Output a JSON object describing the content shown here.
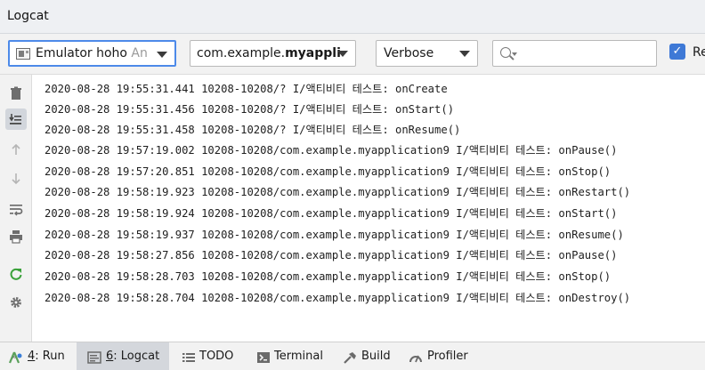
{
  "window": {
    "title": "Logcat"
  },
  "toolbar": {
    "device": {
      "name": "Emulator hoho",
      "suffix": "An"
    },
    "package": {
      "prefix": "com.example.",
      "bold": "myappli"
    },
    "log_level": "Verbose",
    "search": {
      "value": ""
    },
    "checkbox": {
      "checked": true,
      "label": "Re"
    }
  },
  "sidebar": {
    "items": [
      {
        "name": "clear-logcat",
        "icon": "trash-icon"
      },
      {
        "name": "scroll-to-end",
        "icon": "scroll-to-end-icon",
        "active": true
      },
      {
        "name": "up-the-stack",
        "icon": "arrow-up-icon"
      },
      {
        "name": "down-the-stack",
        "icon": "arrow-down-icon"
      },
      {
        "name": "soft-wrap",
        "icon": "soft-wrap-icon"
      },
      {
        "name": "print",
        "icon": "print-icon"
      },
      {
        "name": "restart",
        "icon": "restart-icon"
      },
      {
        "name": "settings",
        "icon": "gear-icon"
      }
    ]
  },
  "log": {
    "lines": [
      "2020-08-28 19:55:31.441 10208-10208/? I/액티비티 테스트: onCreate",
      "2020-08-28 19:55:31.456 10208-10208/? I/액티비티 테스트: onStart()",
      "2020-08-28 19:55:31.458 10208-10208/? I/액티비티 테스트: onResume()",
      "2020-08-28 19:57:19.002 10208-10208/com.example.myapplication9 I/액티비티 테스트: onPause()",
      "2020-08-28 19:57:20.851 10208-10208/com.example.myapplication9 I/액티비티 테스트: onStop()",
      "2020-08-28 19:58:19.923 10208-10208/com.example.myapplication9 I/액티비티 테스트: onRestart()",
      "2020-08-28 19:58:19.924 10208-10208/com.example.myapplication9 I/액티비티 테스트: onStart()",
      "2020-08-28 19:58:19.937 10208-10208/com.example.myapplication9 I/액티비티 테스트: onResume()",
      "2020-08-28 19:58:27.856 10208-10208/com.example.myapplication9 I/액티비티 테스트: onPause()",
      "2020-08-28 19:58:28.703 10208-10208/com.example.myapplication9 I/액티비티 테스트: onStop()",
      "2020-08-28 19:58:28.704 10208-10208/com.example.myapplication9 I/액티비티 테스트: onDestroy()"
    ]
  },
  "bottom": {
    "expand": "»",
    "tabs": [
      {
        "num": "4",
        "label": ": Run",
        "icon": "run-icon"
      },
      {
        "num": "6",
        "label": ": Logcat",
        "icon": "logcat-icon",
        "active": true
      },
      {
        "num": "",
        "label": "TODO",
        "icon": "todo-icon"
      },
      {
        "num": "",
        "label": "Terminal",
        "icon": "terminal-icon"
      },
      {
        "num": "",
        "label": "Build",
        "icon": "build-icon"
      },
      {
        "num": "",
        "label": "Profiler",
        "icon": "profiler-icon"
      }
    ]
  },
  "colors": {
    "accent": "#3e79d6",
    "focus_border": "#4d8ae9",
    "restart_green": "#3aa13a"
  }
}
